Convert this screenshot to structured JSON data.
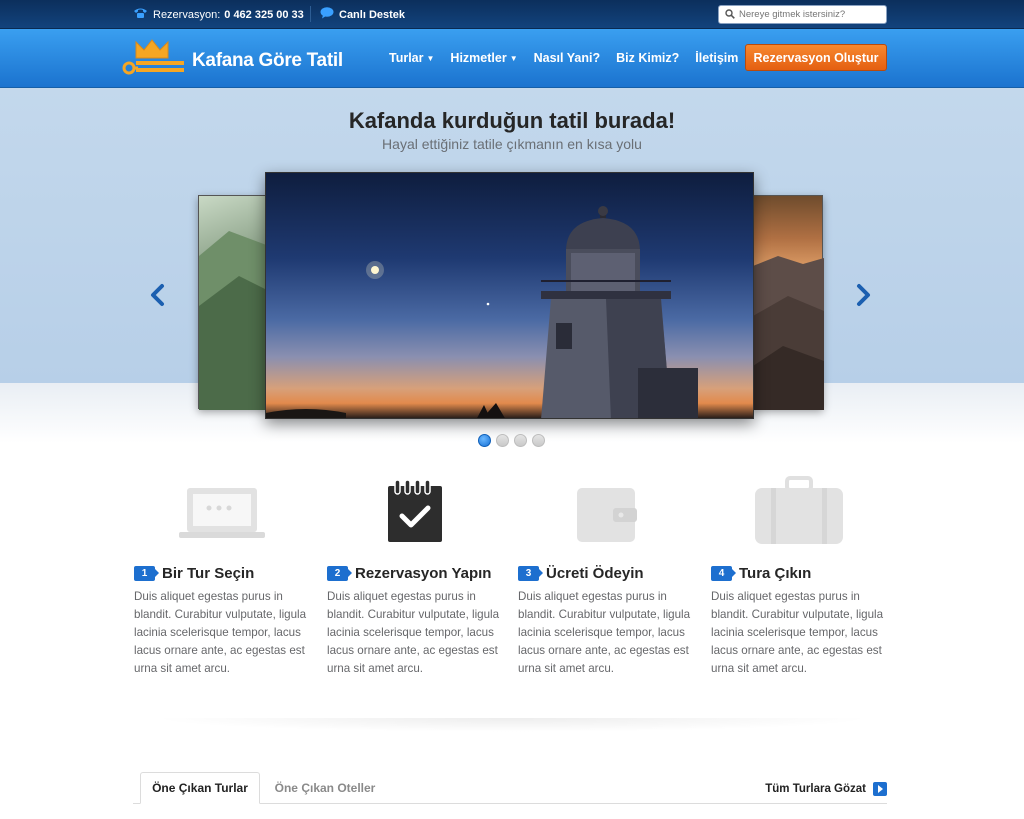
{
  "topbar": {
    "reservation_label": "Rezervasyon:",
    "reservation_phone": "0 462 325 00 33",
    "support_label": "Canlı Destek",
    "search_placeholder": "Nereye gitmek istersiniz?"
  },
  "header": {
    "logo_text": "Kafana Göre Tatil",
    "nav": [
      {
        "label": "Turlar",
        "has_dropdown": true
      },
      {
        "label": "Hizmetler",
        "has_dropdown": true
      },
      {
        "label": "Nasıl Yani?",
        "has_dropdown": false
      },
      {
        "label": "Biz Kimiz?",
        "has_dropdown": false
      },
      {
        "label": "İletişim",
        "has_dropdown": false
      }
    ],
    "cta_label": "Rezervasyon Oluştur"
  },
  "hero": {
    "title": "Kafanda kurduğun tatil burada!",
    "subtitle": "Hayal ettiğiniz tatile çıkmanın en kısa yolu",
    "slide_count": 4,
    "active_slide": 1
  },
  "steps": [
    {
      "number": "1",
      "title": "Bir Tur Seçin",
      "icon": "laptop-icon",
      "description": "Duis aliquet egestas purus in blandit. Curabitur vulputate, ligula lacinia scelerisque tempor, lacus lacus ornare ante, ac egestas est urna sit amet arcu."
    },
    {
      "number": "2",
      "title": "Rezervasyon Yapın",
      "icon": "notepad-check-icon",
      "description": "Duis aliquet egestas purus in blandit. Curabitur vulputate, ligula lacinia scelerisque tempor, lacus lacus ornare ante, ac egestas est urna sit amet arcu."
    },
    {
      "number": "3",
      "title": "Ücreti Ödeyin",
      "icon": "wallet-icon",
      "description": "Duis aliquet egestas purus in blandit. Curabitur vulputate, ligula lacinia scelerisque tempor, lacus lacus ornare ante, ac egestas est urna sit amet arcu."
    },
    {
      "number": "4",
      "title": "Tura Çıkın",
      "icon": "suitcase-icon",
      "description": "Duis aliquet egestas purus in blandit. Curabitur vulputate, ligula lacinia scelerisque tempor, lacus lacus ornare ante, ac egestas est urna sit amet arcu."
    }
  ],
  "tabs": {
    "items": [
      "Öne Çıkan Turlar",
      "Öne Çıkan Oteller"
    ],
    "active": 0,
    "all_link": "Tüm Turlara Gözat"
  },
  "colors": {
    "topbar": "#12437d",
    "nav_blue": "#2a8be3",
    "cta_orange": "#f07a22",
    "accent_blue": "#1d6fcf",
    "logo_crown": "#f5a623"
  }
}
